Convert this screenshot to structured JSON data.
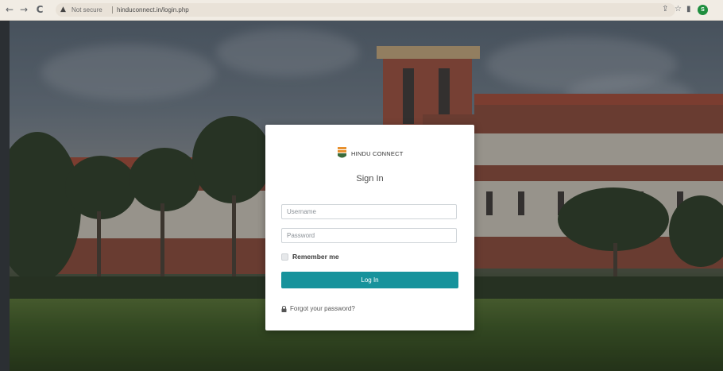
{
  "browser": {
    "back_icon": "←",
    "forward_icon": "→",
    "reload_icon": "C",
    "warning_icon": "▲",
    "security_text": "Not secure",
    "url": "hinduconnect.in/login.php",
    "share_icon": "⇪",
    "star_icon": "☆",
    "sidebar_icon": "▮",
    "profile_initial": "S",
    "profile_color": "#1e8e3e"
  },
  "login": {
    "brand": "HINDU CONNECT",
    "title": "Sign In",
    "username_placeholder": "Username",
    "password_placeholder": "Password",
    "remember_label": "Remember me",
    "remember_checked": false,
    "login_button": "Log In",
    "forgot_link": "Forgot your password?"
  },
  "colors": {
    "primary": "#17939c",
    "logo_orange": "#e8912f",
    "logo_green": "#3a6b3a"
  }
}
